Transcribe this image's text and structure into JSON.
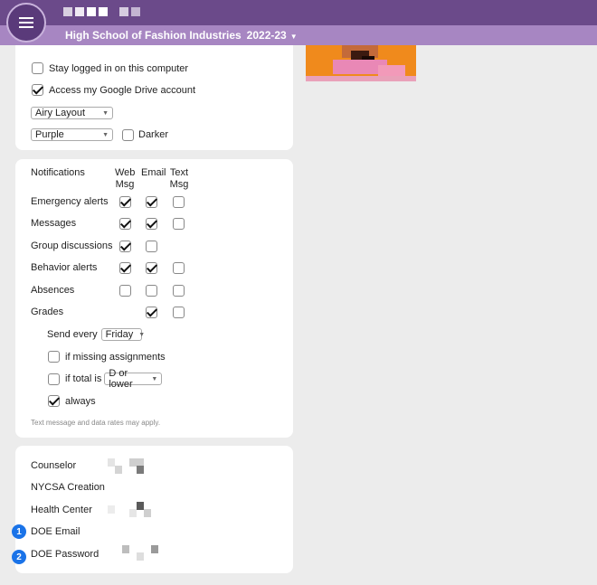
{
  "header": {
    "school": "High School of Fashion Industries",
    "year": "2022-23"
  },
  "settings": {
    "stay_logged_in": "Stay logged in on this computer",
    "google_drive": "Access my Google Drive account",
    "layout_value": "Airy Layout",
    "color_value": "Purple",
    "darker": "Darker"
  },
  "notifications": {
    "title": "Notifications",
    "col_web": "Web Msg",
    "col_email": "Email",
    "col_text": "Text Msg",
    "rows": [
      {
        "label": "Emergency alerts",
        "web": true,
        "email": true,
        "text": false
      },
      {
        "label": "Messages",
        "web": true,
        "email": true,
        "text": false
      },
      {
        "label": "Group discussions",
        "web": true,
        "email": false
      },
      {
        "label": "Behavior alerts",
        "web": true,
        "email": true,
        "text": false
      },
      {
        "label": "Absences",
        "web": false,
        "email": false,
        "text": false
      },
      {
        "label": "Grades",
        "email": true,
        "text": false
      }
    ],
    "send_every": "Send every",
    "send_day": "Friday",
    "if_missing": "if missing assignments",
    "if_total": "if total is",
    "threshold": "D or lower",
    "always": "always",
    "note": "Text message and data rates may apply."
  },
  "contacts": {
    "counselor": "Counselor",
    "nycsa": "NYCSA Creation",
    "health": "Health Center",
    "doe_email": "DOE Email",
    "doe_password": "DOE Password",
    "badge1": "1",
    "badge2": "2"
  }
}
